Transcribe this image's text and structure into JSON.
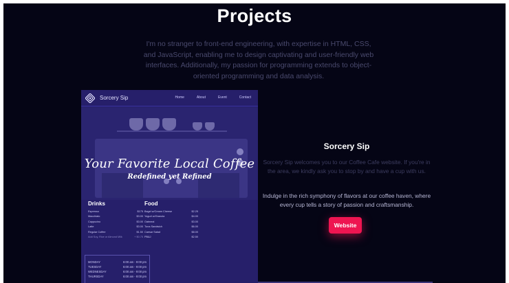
{
  "section": {
    "title": "Projects",
    "intro": "I'm no stranger to front-end engineering, with expertise in HTML, CSS, and JavaScript, enabling me to design captivating and user-friendly web interfaces. Additionally, my passion for programming extends to object-oriented programming and data analysis."
  },
  "project": {
    "title": "Sorcery Sip",
    "description_1": "Sorcery Sip welcomes you to our Coffee Cafe website. If you're in the area, we kindly ask you to stop by and have a cup with us.",
    "description_2": "Indulge in the rich symphony of flavors at our coffee haven, where every cup tells a story of passion and craftsmanship.",
    "button_label": "Website",
    "accent_color": "#ee1551"
  },
  "preview": {
    "brand": "Sorcery Sip",
    "logo_icon": "diamond-logo-icon",
    "nav": [
      "Home",
      "About",
      "Event",
      "Contact"
    ],
    "hero_label": "[Espresso]",
    "hero_title": "Your Favorite Local Coffee",
    "hero_subtitle": "Redefined yet Refined",
    "drinks_heading": "Drinks",
    "drinks": [
      {
        "name": "Espresso",
        "price": "$175"
      },
      {
        "name": "Macchiato",
        "price": "$3.00"
      },
      {
        "name": "Cappucino",
        "price": "$3.00"
      },
      {
        "name": "Latte",
        "price": "$3.00"
      },
      {
        "name": "Regular Coffee",
        "price": "$1.50"
      },
      {
        "name": "Add Soy, Rice or Almond Milk",
        "price": "+ $0.75"
      }
    ],
    "food_heading": "Food",
    "food": [
      {
        "name": "Bagel w/Cream Cheese",
        "price": "$2.25"
      },
      {
        "name": "Yogurt w/Granola",
        "price": "$4.00"
      },
      {
        "name": "Oatmeal",
        "price": "$3.00"
      },
      {
        "name": "Tuna Sandwich",
        "price": "$6.00"
      },
      {
        "name": "Caesar Salad",
        "price": "$8.00"
      },
      {
        "name": "PB&J",
        "price": "$2.50"
      }
    ],
    "hours": [
      {
        "day": "MONDAY",
        "time": "6:00 am - 9:00 pm"
      },
      {
        "day": "TUESDAY",
        "time": "6:00 am - 9:00 pm"
      },
      {
        "day": "WEDNESDAY",
        "time": "6:00 am - 9:00 pm"
      },
      {
        "day": "THURSDAY",
        "time": "6:00 am - 9:00 pm"
      }
    ]
  }
}
